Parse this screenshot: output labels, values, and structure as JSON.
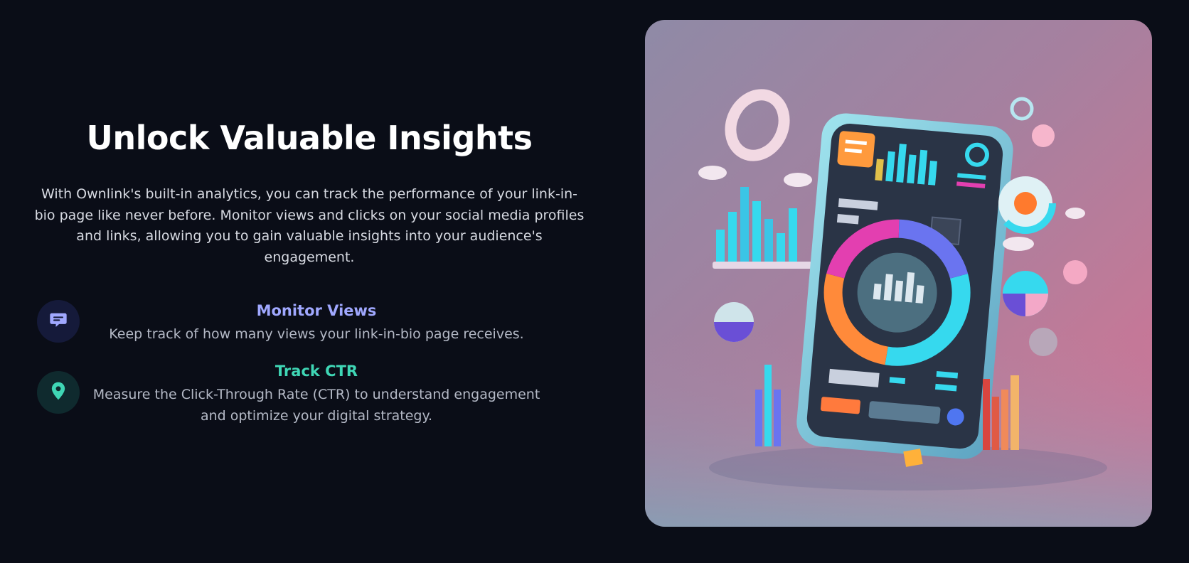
{
  "section": {
    "title": "Unlock Valuable Insights",
    "intro": "With Ownlink's built-in analytics, you can track the performance of your link-in-bio page like never before. Monitor views and clicks on your social media profiles and links, allowing you to gain valuable insights into your audience's engagement."
  },
  "features": [
    {
      "icon": "chat-message-icon",
      "title": "Monitor Views",
      "description": "Keep track of how many views your link-in-bio page receives.",
      "color": "#a0a8ff"
    },
    {
      "icon": "map-pin-icon",
      "title": "Track CTR",
      "description": "Measure the Click-Through Rate (CTR) to understand engagement and optimize your digital strategy.",
      "color": "#3fd6b5"
    }
  ],
  "illustration": {
    "subject": "3d-analytics-phone-illustration",
    "colors": {
      "cyan": "#36d9ee",
      "magenta": "#e33fb0",
      "orange": "#ff8a3a",
      "purple": "#6a4fd6"
    }
  }
}
